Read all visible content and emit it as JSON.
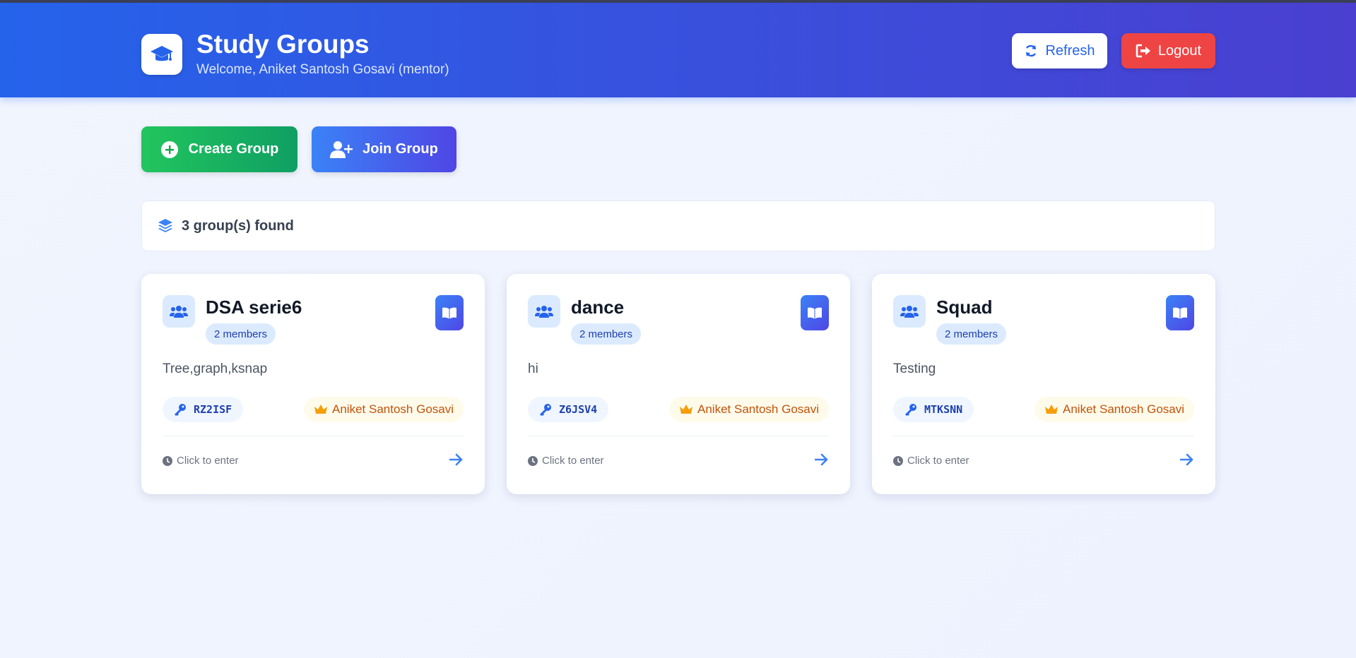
{
  "header": {
    "title": "Study Groups",
    "subtitle": "Welcome, Aniket Santosh Gosavi (mentor)",
    "refresh_label": "Refresh",
    "logout_label": "Logout"
  },
  "actions": {
    "create_label": "Create Group",
    "join_label": "Join Group"
  },
  "summary": {
    "count_text": "3 group(s) found"
  },
  "groups": [
    {
      "name": "DSA serie6",
      "members": "2 members",
      "description": "Tree,graph,ksnap",
      "code": "RZ2ISF",
      "owner": "Aniket Santosh Gosavi",
      "enter": "Click to enter"
    },
    {
      "name": "dance",
      "members": "2 members",
      "description": "hi",
      "code": "Z6JSV4",
      "owner": "Aniket Santosh Gosavi",
      "enter": "Click to enter"
    },
    {
      "name": "Squad",
      "members": "2 members",
      "description": "Testing",
      "code": "MTKSNN",
      "owner": "Aniket Santosh Gosavi",
      "enter": "Click to enter"
    }
  ],
  "icons": {
    "brand": "graduation-cap-icon",
    "refresh": "refresh-icon",
    "logout": "logout-icon",
    "create": "plus-circle-icon",
    "join": "user-plus-icon",
    "count": "layers-icon",
    "group": "users-icon",
    "book": "book-icon",
    "code": "key-icon",
    "owner": "crown-icon",
    "enter": "clock-icon",
    "arrow": "arrow-right-icon"
  },
  "colors": {
    "header_start": "#2563eb",
    "header_end": "#4a3fd0",
    "create_green": "#22c55e",
    "logout_red": "#ef4444",
    "owner_orange": "#c2530b"
  }
}
